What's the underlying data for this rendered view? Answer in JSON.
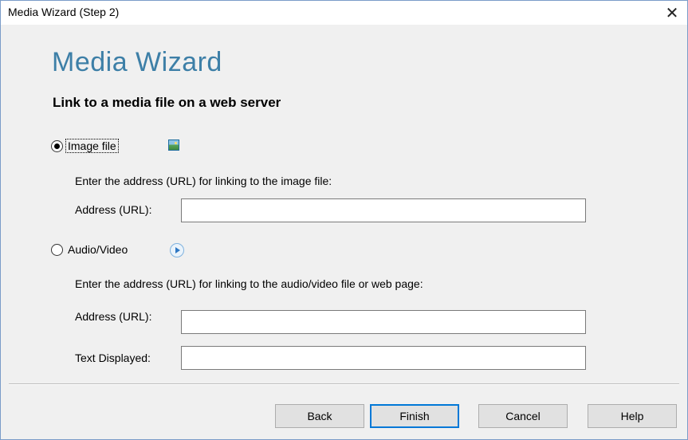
{
  "window": {
    "title": "Media Wizard (Step 2)",
    "close_glyph": "✕"
  },
  "header": {
    "title": "Media Wizard",
    "subtitle": "Link to a media file on a web server"
  },
  "image_option": {
    "label": "Image file",
    "selected": true,
    "icon": "image-icon",
    "instruction": "Enter the address (URL) for linking to the image file:",
    "address_label": "Address (URL):",
    "address_value": ""
  },
  "av_option": {
    "label": "Audio/Video",
    "selected": false,
    "icon": "play-icon",
    "instruction": "Enter the address (URL) for linking to the audio/video file or web page:",
    "address_label": "Address (URL):",
    "address_value": "",
    "text_label": "Text Displayed:",
    "text_value": ""
  },
  "buttons": {
    "back": "Back",
    "finish": "Finish",
    "cancel": "Cancel",
    "help": "Help"
  },
  "colors": {
    "heading": "#3d7fa7",
    "default_button_border": "#0078d7",
    "window_border": "#7a9cc8"
  }
}
